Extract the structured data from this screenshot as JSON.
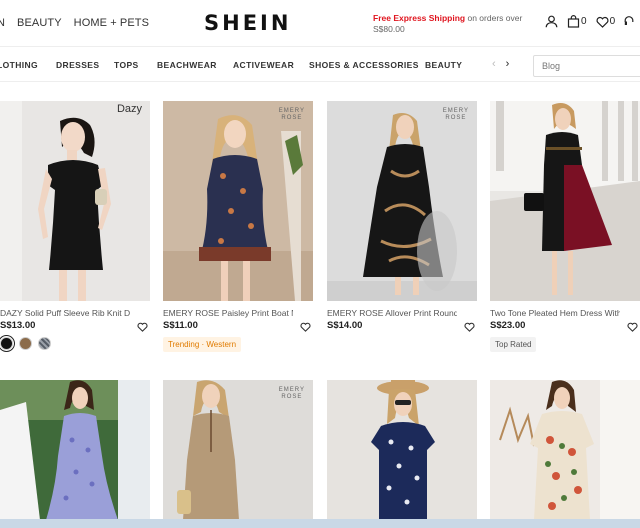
{
  "header": {
    "nav": [
      "N",
      "BEAUTY",
      "HOME + PETS"
    ],
    "logo": "SHEIN",
    "promo_strong": "Free Express Shipping",
    "promo_rest": " on orders over S$80.00",
    "cart_count": "0",
    "wishlist_count": "0",
    "brand_color": "#e0141e"
  },
  "categories": {
    "items": [
      "LOTHING",
      "DRESSES",
      "TOPS",
      "BEACHWEAR",
      "ACTIVEWEAR",
      "SHOES & ACCESSORIES",
      "BEAUTY"
    ],
    "search_placeholder": "Blog"
  },
  "products": [
    {
      "brand": "Dazy",
      "title": "DAZY Solid Puff Sleeve Rib Knit Dress",
      "price": "S$13.00",
      "swatches": [
        "#111111",
        "#8b6b4a",
        "#555c66"
      ]
    },
    {
      "brand": "EMERY ROSE",
      "title": "EMERY ROSE Paisley Print Boat Nec...",
      "price": "S$11.00",
      "badge": "Trending · Western"
    },
    {
      "brand": "EMERY ROSE",
      "title": "EMERY ROSE Allover Print Round Ne...",
      "price": "S$14.00"
    },
    {
      "brand": "",
      "title": "Two Tone Pleated Hem Dress Without...",
      "price": "S$23.00",
      "badge": "Top Rated"
    },
    {
      "brand": "",
      "title": "",
      "price": ""
    },
    {
      "brand": "EMERY ROSE",
      "title": "",
      "price": ""
    },
    {
      "brand": "",
      "title": "",
      "price": ""
    },
    {
      "brand": "",
      "title": "",
      "price": ""
    }
  ]
}
